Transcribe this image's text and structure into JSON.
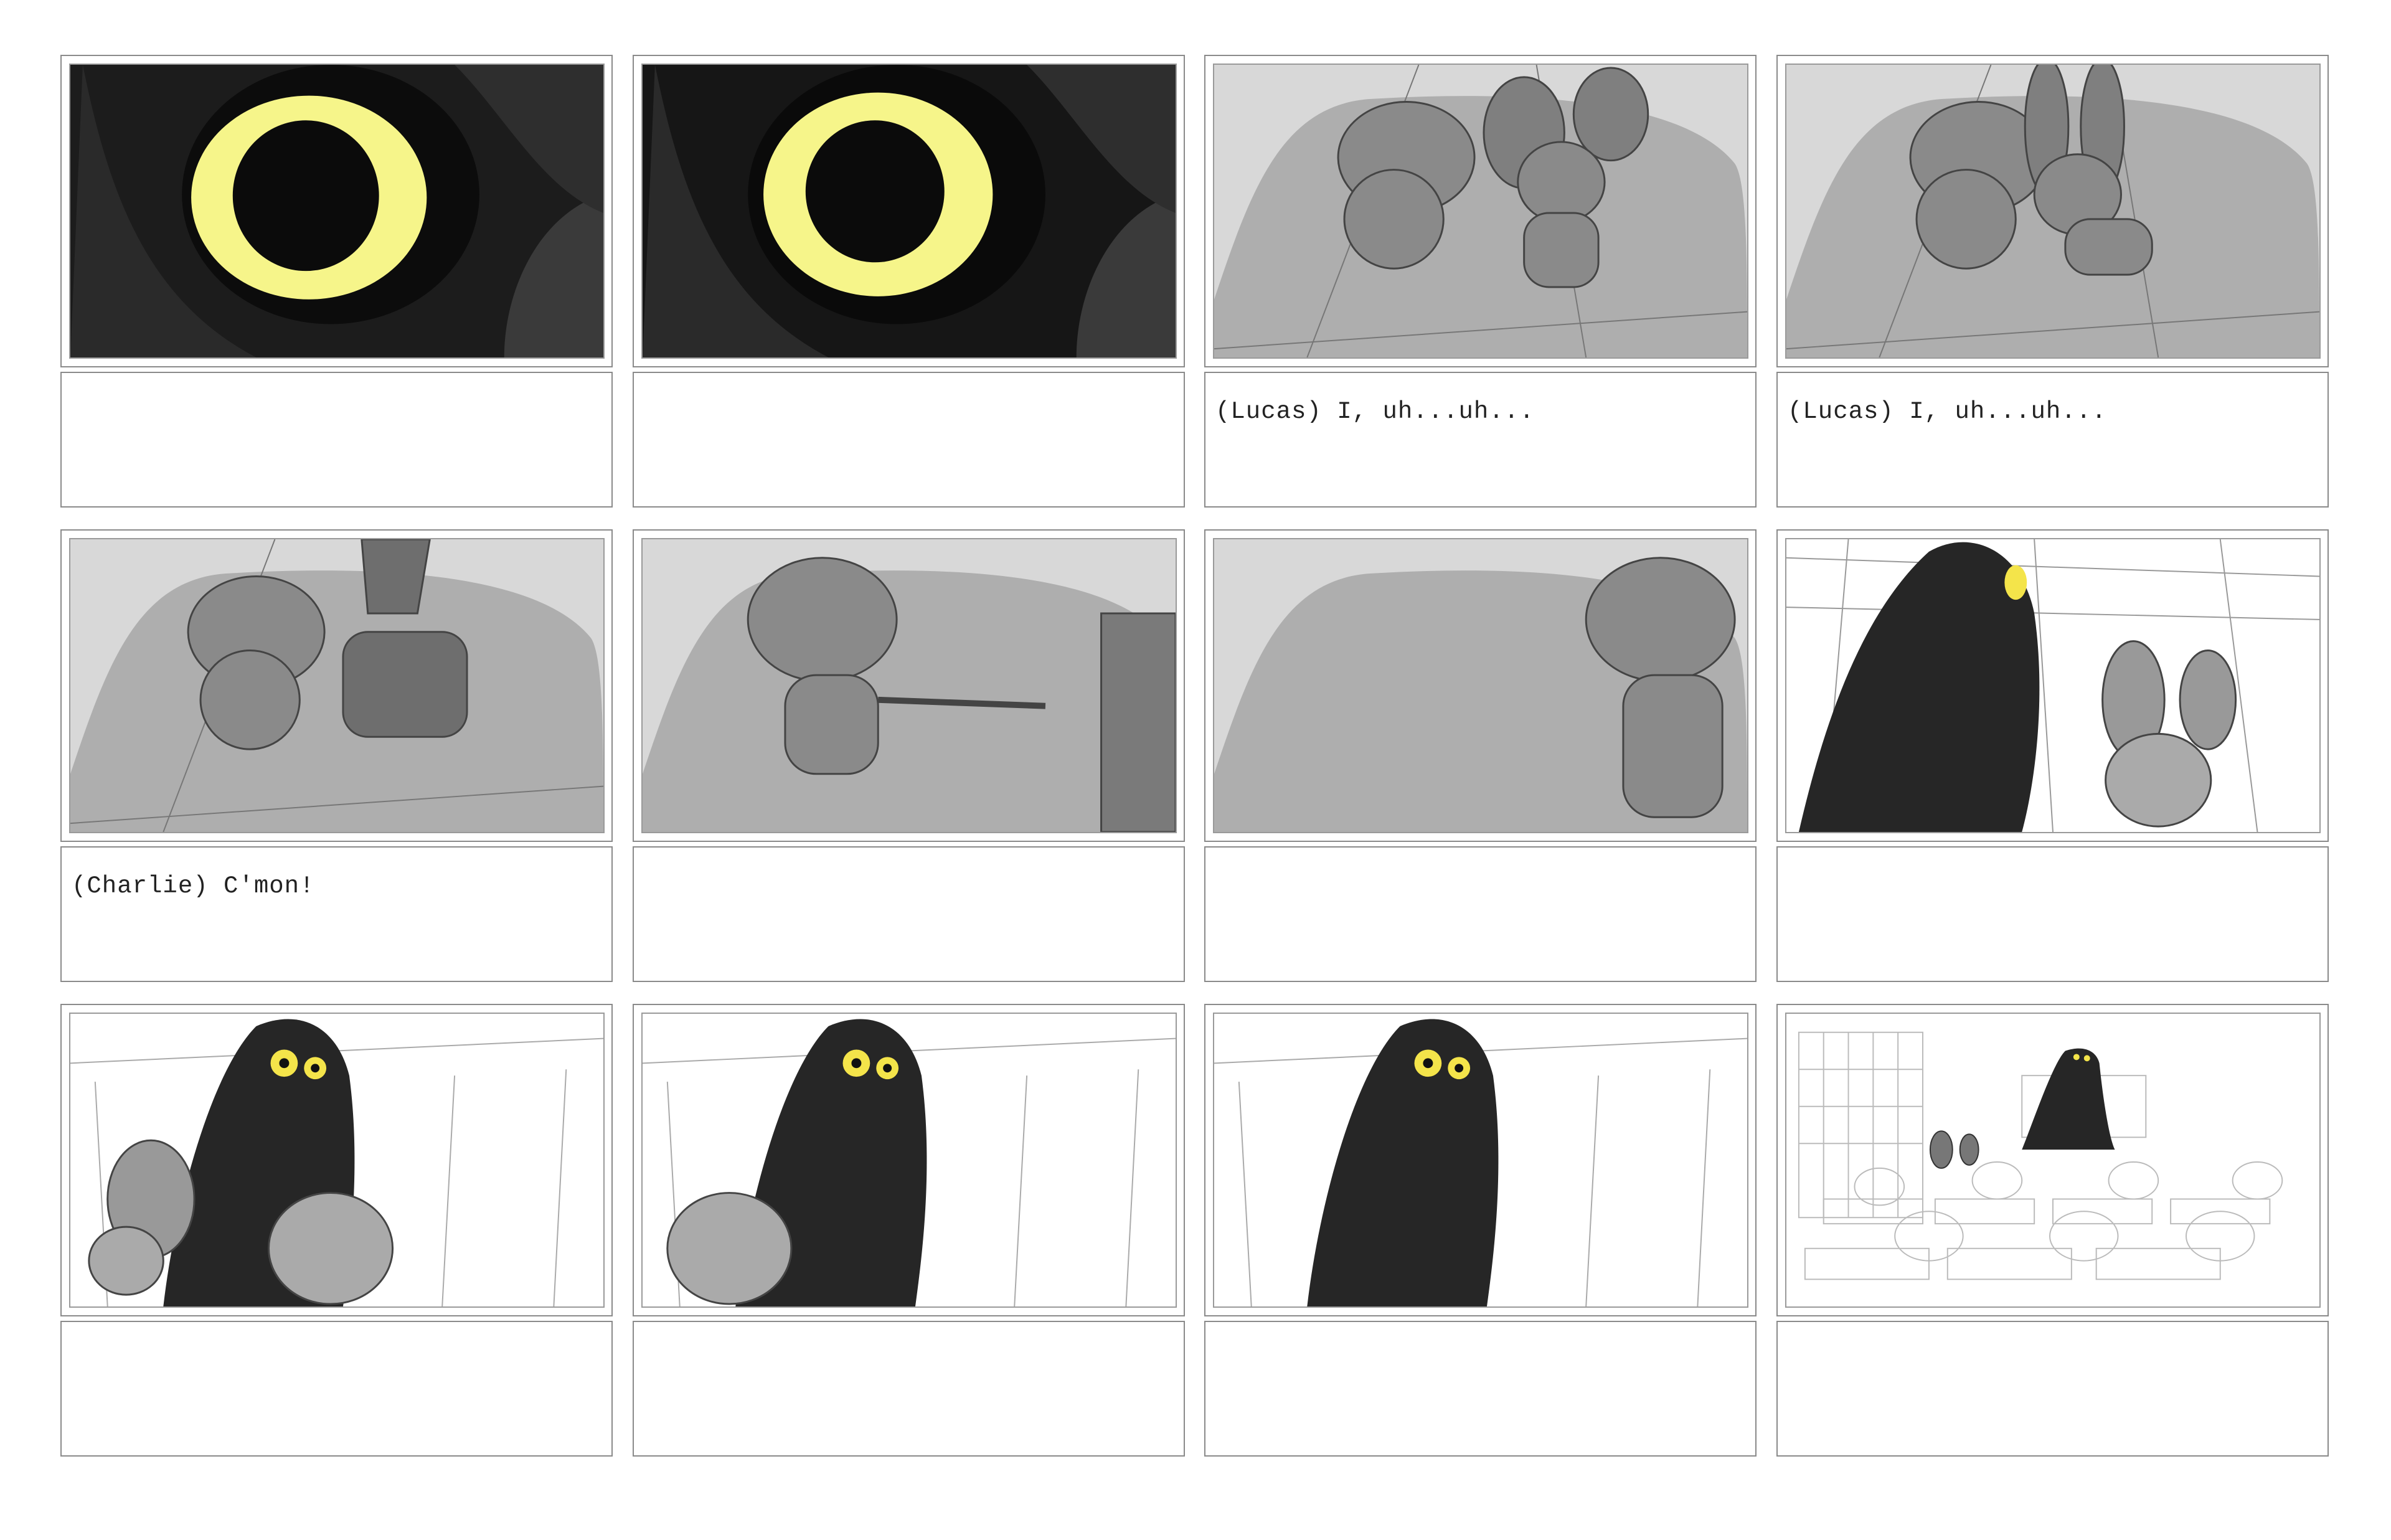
{
  "storyboard": {
    "panels": [
      {
        "id": 1,
        "scene": "glowing-eye-closeup",
        "dialogue": ""
      },
      {
        "id": 2,
        "scene": "glowing-eye-closeup",
        "dialogue": ""
      },
      {
        "id": 3,
        "scene": "two-mice-sitting",
        "dialogue": "(Lucas) I, uh...uh..."
      },
      {
        "id": 4,
        "scene": "rabbit-whispering",
        "dialogue": "(Lucas) I, uh...uh..."
      },
      {
        "id": 5,
        "scene": "rabbit-pulling-mouse",
        "dialogue": "(Charlie) C'mon!"
      },
      {
        "id": 6,
        "scene": "mouse-being-pulled",
        "dialogue": ""
      },
      {
        "id": 7,
        "scene": "mouse-exits-frame",
        "dialogue": ""
      },
      {
        "id": 8,
        "scene": "owl-looms-over-mouse",
        "dialogue": ""
      },
      {
        "id": 9,
        "scene": "owl-watches-escape",
        "dialogue": ""
      },
      {
        "id": 10,
        "scene": "owl-watches-escape",
        "dialogue": ""
      },
      {
        "id": 11,
        "scene": "owl-alone",
        "dialogue": ""
      },
      {
        "id": 12,
        "scene": "classroom-wide-shot",
        "dialogue": ""
      }
    ],
    "colors": {
      "eye_glow": "#f6f58a",
      "pupil": "#0b0b0b",
      "dark_bg": "#1e1e1e",
      "floor_gray": "#aeaeae",
      "character_gray": "#8a8a8a",
      "owl_black": "#262626",
      "owl_eye": "#f4e44a"
    }
  }
}
